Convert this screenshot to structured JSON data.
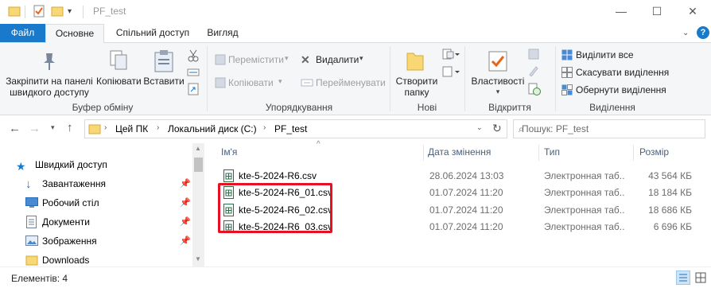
{
  "window": {
    "title": "PF_test"
  },
  "tabs": {
    "file": "Файл",
    "home": "Основне",
    "share": "Спільний доступ",
    "view": "Вигляд"
  },
  "ribbon": {
    "pin": "Закріпити на панелі швидкого доступу",
    "pin_line1": "Закріпити на панелі",
    "pin_line2": "швидкого доступу",
    "copy": "Копіювати",
    "paste": "Вставити",
    "clipboard_group": "Буфер обміну",
    "move_to": "Перемістити",
    "copy_to": "Копіювати",
    "delete": "Видалити",
    "rename": "Перейменувати",
    "organize_group": "Упорядкування",
    "new_folder_line1": "Створити",
    "new_folder_line2": "папку",
    "new_group": "Нові",
    "properties": "Властивості",
    "open_group": "Відкриття",
    "select_all": "Виділити все",
    "select_none": "Скасувати виділення",
    "invert_selection": "Обернути виділення",
    "select_group": "Виділення"
  },
  "address": {
    "path": [
      "Цей ПК",
      "Локальний диск (C:)",
      "PF_test"
    ],
    "search_placeholder": "Пошук: PF_test"
  },
  "nav_pane": {
    "items": [
      {
        "label": "Швидкий доступ",
        "icon": "star-icon"
      },
      {
        "label": "Завантаження",
        "icon": "download-icon"
      },
      {
        "label": "Робочий стіл",
        "icon": "desktop-icon"
      },
      {
        "label": "Документи",
        "icon": "documents-icon"
      },
      {
        "label": "Зображення",
        "icon": "pictures-icon"
      },
      {
        "label": "Downloads",
        "icon": "folder-icon"
      }
    ]
  },
  "columns": {
    "name": "Ім'я",
    "date": "Дата змінення",
    "type": "Тип",
    "size": "Розмір"
  },
  "files": [
    {
      "name": "kte-5-2024-R6.csv",
      "date": "28.06.2024 13:03",
      "type": "Электронная таб...",
      "size": "43 564 КБ"
    },
    {
      "name": "kte-5-2024-R6_01.csv",
      "date": "01.07.2024 11:20",
      "type": "Электронная таб...",
      "size": "18 184 КБ"
    },
    {
      "name": "kte-5-2024-R6_02.csv",
      "date": "01.07.2024 11:20",
      "type": "Электронная таб...",
      "size": "18 686 КБ"
    },
    {
      "name": "kte-5-2024-R6_03.csv",
      "date": "01.07.2024 11:20",
      "type": "Электронная таб...",
      "size": "6 696 КБ"
    }
  ],
  "status": {
    "count": "Елементів: 4"
  },
  "colors": {
    "accent": "#1979ca",
    "highlight_box": "#e81123",
    "folder": "#f8d775"
  }
}
